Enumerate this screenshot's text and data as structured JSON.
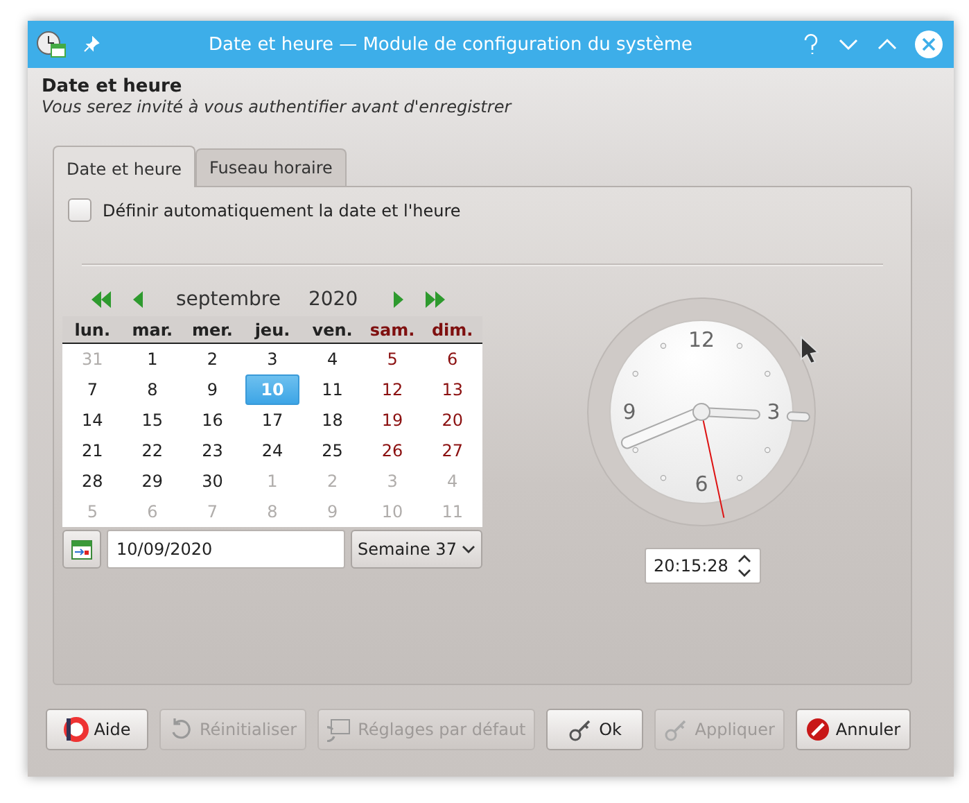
{
  "window": {
    "title": "Date et heure — Module de configuration du système"
  },
  "header": {
    "title": "Date et heure",
    "subtitle": "Vous serez invité à vous authentifier avant d'enregistrer"
  },
  "tabs": [
    {
      "label": "Date et heure",
      "selected": true
    },
    {
      "label": "Fuseau horaire",
      "selected": false
    }
  ],
  "auto_checkbox": {
    "label": "Définir automatiquement la date et l'heure",
    "checked": false
  },
  "calendar": {
    "month": "septembre",
    "year": "2020",
    "weekdays": [
      {
        "label": "lun.",
        "weekend": false
      },
      {
        "label": "mar.",
        "weekend": false
      },
      {
        "label": "mer.",
        "weekend": false
      },
      {
        "label": "jeu.",
        "weekend": false
      },
      {
        "label": "ven.",
        "weekend": false
      },
      {
        "label": "sam.",
        "weekend": true
      },
      {
        "label": "dim.",
        "weekend": true
      }
    ],
    "weeks": [
      [
        {
          "day": "31",
          "muted": true,
          "selected": false
        },
        {
          "day": "1",
          "muted": false,
          "selected": false
        },
        {
          "day": "2",
          "muted": false,
          "selected": false
        },
        {
          "day": "3",
          "muted": false,
          "selected": false
        },
        {
          "day": "4",
          "muted": false,
          "selected": false
        },
        {
          "day": "5",
          "muted": false,
          "selected": false
        },
        {
          "day": "6",
          "muted": false,
          "selected": false
        }
      ],
      [
        {
          "day": "7",
          "muted": false,
          "selected": false
        },
        {
          "day": "8",
          "muted": false,
          "selected": false
        },
        {
          "day": "9",
          "muted": false,
          "selected": false
        },
        {
          "day": "10",
          "muted": false,
          "selected": true
        },
        {
          "day": "11",
          "muted": false,
          "selected": false
        },
        {
          "day": "12",
          "muted": false,
          "selected": false
        },
        {
          "day": "13",
          "muted": false,
          "selected": false
        }
      ],
      [
        {
          "day": "14",
          "muted": false,
          "selected": false
        },
        {
          "day": "15",
          "muted": false,
          "selected": false
        },
        {
          "day": "16",
          "muted": false,
          "selected": false
        },
        {
          "day": "17",
          "muted": false,
          "selected": false
        },
        {
          "day": "18",
          "muted": false,
          "selected": false
        },
        {
          "day": "19",
          "muted": false,
          "selected": false
        },
        {
          "day": "20",
          "muted": false,
          "selected": false
        }
      ],
      [
        {
          "day": "21",
          "muted": false,
          "selected": false
        },
        {
          "day": "22",
          "muted": false,
          "selected": false
        },
        {
          "day": "23",
          "muted": false,
          "selected": false
        },
        {
          "day": "24",
          "muted": false,
          "selected": false
        },
        {
          "day": "25",
          "muted": false,
          "selected": false
        },
        {
          "day": "26",
          "muted": false,
          "selected": false
        },
        {
          "day": "27",
          "muted": false,
          "selected": false
        }
      ],
      [
        {
          "day": "28",
          "muted": false,
          "selected": false
        },
        {
          "day": "29",
          "muted": false,
          "selected": false
        },
        {
          "day": "30",
          "muted": false,
          "selected": false
        },
        {
          "day": "1",
          "muted": true,
          "selected": false
        },
        {
          "day": "2",
          "muted": true,
          "selected": false
        },
        {
          "day": "3",
          "muted": true,
          "selected": false
        },
        {
          "day": "4",
          "muted": true,
          "selected": false
        }
      ],
      [
        {
          "day": "5",
          "muted": true,
          "selected": false
        },
        {
          "day": "6",
          "muted": true,
          "selected": false
        },
        {
          "day": "7",
          "muted": true,
          "selected": false
        },
        {
          "day": "8",
          "muted": true,
          "selected": false
        },
        {
          "day": "9",
          "muted": true,
          "selected": false
        },
        {
          "day": "10",
          "muted": true,
          "selected": false
        },
        {
          "day": "11",
          "muted": true,
          "selected": false
        }
      ]
    ],
    "date_value": "10/09/2020",
    "week_select": "Semaine 37"
  },
  "clock": {
    "numerals": [
      "12",
      "3",
      "6",
      "9"
    ],
    "time": "20:15:28"
  },
  "buttons": [
    {
      "label": "Aide",
      "kind": "help",
      "disabled": false
    },
    {
      "label": "Réinitialiser",
      "kind": "reset",
      "disabled": true
    },
    {
      "label": "Réglages par défaut",
      "kind": "defaults",
      "disabled": true
    },
    {
      "label": "Ok",
      "kind": "key",
      "disabled": false
    },
    {
      "label": "Appliquer",
      "kind": "key",
      "disabled": true
    },
    {
      "label": "Annuler",
      "kind": "cancel",
      "disabled": false
    }
  ]
}
